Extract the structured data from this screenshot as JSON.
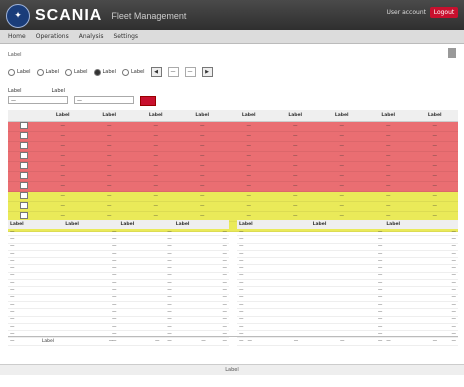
{
  "header": {
    "brand": "SCANIA",
    "product": "Fleet Management",
    "user": "User account",
    "logout_label": "Logout",
    "brand_color": "#1a3d7a",
    "accent_color": "#c8102e"
  },
  "nav": {
    "items": [
      "Home",
      "Operations",
      "Analysis",
      "Settings"
    ]
  },
  "breadcrumb": "Label",
  "filters": {
    "periods": [
      {
        "label": "Label",
        "selected": false
      },
      {
        "label": "Label",
        "selected": false
      },
      {
        "label": "Label",
        "selected": false
      },
      {
        "label": "Label",
        "selected": true
      },
      {
        "label": "Label",
        "selected": false
      }
    ],
    "year_value": "—",
    "month_value": "—",
    "prev_label": "◀",
    "next_label": "▶"
  },
  "group_filter": {
    "group_label": "Label",
    "driver_label": "Label",
    "group_value": "—",
    "driver_value": "—"
  },
  "table": {
    "columns": [
      "",
      "Label",
      "Label",
      "Label",
      "Label",
      "Label",
      "Label",
      "Label",
      "Label",
      "Label"
    ],
    "rows": [
      {
        "status": "red",
        "cells": [
          "—",
          "—",
          "—",
          "—",
          "—",
          "—",
          "—",
          "—",
          "—"
        ]
      },
      {
        "status": "red",
        "cells": [
          "—",
          "—",
          "—",
          "—",
          "—",
          "—",
          "—",
          "—",
          "—"
        ]
      },
      {
        "status": "red",
        "cells": [
          "—",
          "—",
          "—",
          "—",
          "—",
          "—",
          "—",
          "—",
          "—"
        ]
      },
      {
        "status": "red",
        "cells": [
          "—",
          "—",
          "—",
          "—",
          "—",
          "—",
          "—",
          "—",
          "—"
        ]
      },
      {
        "status": "red",
        "cells": [
          "—",
          "—",
          "—",
          "—",
          "—",
          "—",
          "—",
          "—",
          "—"
        ]
      },
      {
        "status": "red",
        "cells": [
          "—",
          "—",
          "—",
          "—",
          "—",
          "—",
          "—",
          "—",
          "—"
        ]
      },
      {
        "status": "red",
        "cells": [
          "—",
          "—",
          "—",
          "—",
          "—",
          "—",
          "—",
          "—",
          "—"
        ]
      },
      {
        "status": "yellow",
        "cells": [
          "—",
          "—",
          "—",
          "—",
          "—",
          "—",
          "—",
          "—",
          "—"
        ]
      },
      {
        "status": "yellow",
        "cells": [
          "—",
          "—",
          "—",
          "—",
          "—",
          "—",
          "—",
          "—",
          "—"
        ]
      },
      {
        "status": "yellow",
        "cells": [
          "—",
          "—",
          "—",
          "—",
          "—",
          "—",
          "—",
          "—",
          "—"
        ]
      },
      {
        "status": "yellow",
        "cells": [
          "—",
          "—",
          "—",
          "—",
          "—",
          "—",
          "—",
          "—",
          "—"
        ]
      }
    ]
  },
  "metrics_left": {
    "columns": [
      "Label",
      "Label",
      "Label",
      "Label"
    ],
    "rows": [
      [
        "—",
        "—",
        "—",
        "—"
      ],
      [
        "—",
        "—",
        "—",
        "—"
      ],
      [
        "—",
        "—",
        "—",
        "—"
      ],
      [
        "—",
        "—",
        "—",
        "—"
      ],
      [
        "—",
        "—",
        "—",
        "—"
      ],
      [
        "—",
        "—",
        "—",
        "—"
      ],
      [
        "—",
        "—",
        "—",
        "—"
      ],
      [
        "—",
        "—",
        "—",
        "—"
      ],
      [
        "—",
        "—",
        "—",
        "—"
      ],
      [
        "—",
        "—",
        "—",
        "—"
      ],
      [
        "—",
        "—",
        "—",
        "—"
      ],
      [
        "—",
        "—",
        "—",
        "—"
      ],
      [
        "—",
        "—",
        "—",
        "—"
      ],
      [
        "—",
        "—",
        "—",
        "—"
      ],
      [
        "—",
        "—",
        "—",
        "—"
      ],
      [
        "—",
        "—",
        "—",
        "—"
      ]
    ]
  },
  "metrics_right": {
    "columns": [
      "Label",
      "Label",
      "Label"
    ],
    "rows": [
      [
        "—",
        "—",
        "—"
      ],
      [
        "—",
        "—",
        "—"
      ],
      [
        "—",
        "—",
        "—"
      ],
      [
        "—",
        "—",
        "—"
      ],
      [
        "—",
        "—",
        "—"
      ],
      [
        "—",
        "—",
        "—"
      ],
      [
        "—",
        "—",
        "—"
      ],
      [
        "—",
        "—",
        "—"
      ],
      [
        "—",
        "—",
        "—"
      ],
      [
        "—",
        "—",
        "—"
      ],
      [
        "—",
        "—",
        "—"
      ],
      [
        "—",
        "—",
        "—"
      ],
      [
        "—",
        "—",
        "—"
      ],
      [
        "—",
        "—",
        "—"
      ],
      [
        "—",
        "—",
        "—"
      ],
      [
        "—",
        "—",
        "—"
      ]
    ]
  },
  "fleet": {
    "label": "Label",
    "cells": [
      "—",
      "—",
      "—",
      "—",
      "—",
      "—",
      "—",
      "—"
    ]
  },
  "footer": "Label"
}
